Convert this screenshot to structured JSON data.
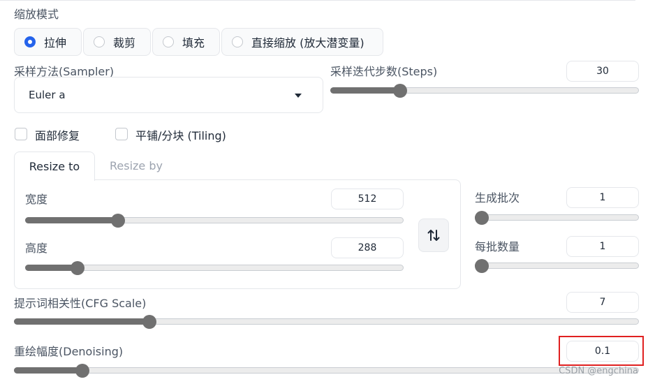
{
  "resize_mode": {
    "label": "缩放模式",
    "options": [
      {
        "label": "拉伸",
        "checked": true
      },
      {
        "label": "裁剪",
        "checked": false
      },
      {
        "label": "填充",
        "checked": false
      },
      {
        "label": "直接缩放 (放大潜变量)",
        "checked": false
      }
    ]
  },
  "sampler": {
    "label": "采样方法(Sampler)",
    "value": "Euler a"
  },
  "steps": {
    "label": "采样迭代步数(Steps)",
    "value": "30",
    "fraction": 0.214
  },
  "checkboxes": {
    "restore_faces": {
      "label": "面部修复",
      "checked": false
    },
    "tiling": {
      "label": "平铺/分块 (Tiling)",
      "checked": false
    }
  },
  "tabs": {
    "resize_to": "Resize to",
    "resize_by": "Resize by"
  },
  "width": {
    "label": "宽度",
    "value": "512",
    "fraction": 0.235
  },
  "height": {
    "label": "高度",
    "value": "288",
    "fraction": 0.125
  },
  "batch_count": {
    "label": "生成批次",
    "value": "1",
    "fraction": 0.0
  },
  "batch_size": {
    "label": "每批数量",
    "value": "1",
    "fraction": 0.0
  },
  "cfg_scale": {
    "label": "提示词相关性(CFG Scale)",
    "value": "7",
    "fraction": 0.21
  },
  "denoising": {
    "label": "重绘幅度(Denoising)",
    "value": "0.1",
    "fraction": 0.1
  },
  "watermark": "CSDN @engchina",
  "colors": {
    "accent": "#2563eb",
    "slider": "#707070",
    "highlight": "#e02020"
  }
}
